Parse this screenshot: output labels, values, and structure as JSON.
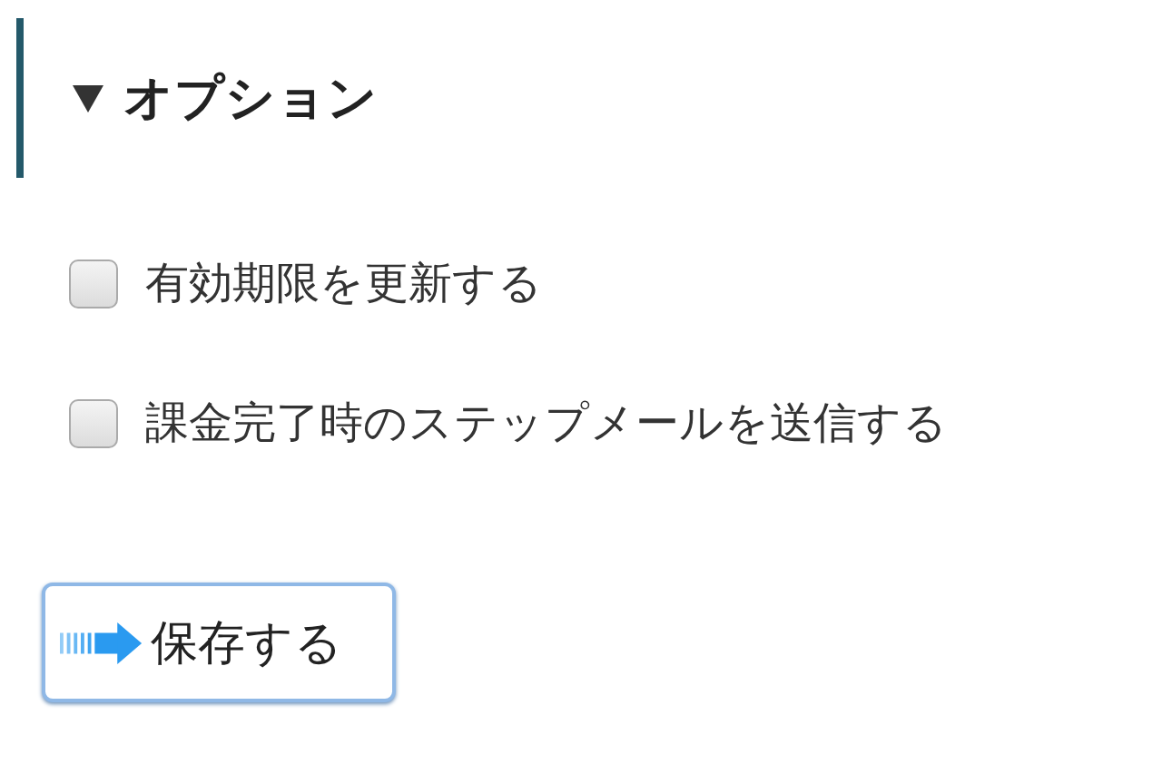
{
  "section": {
    "title": "オプション",
    "expanded": true
  },
  "options": [
    {
      "label": "有効期限を更新する",
      "checked": false
    },
    {
      "label": "課金完了時のステップメールを送信する",
      "checked": false
    }
  ],
  "save_button": {
    "label": "保存する"
  }
}
